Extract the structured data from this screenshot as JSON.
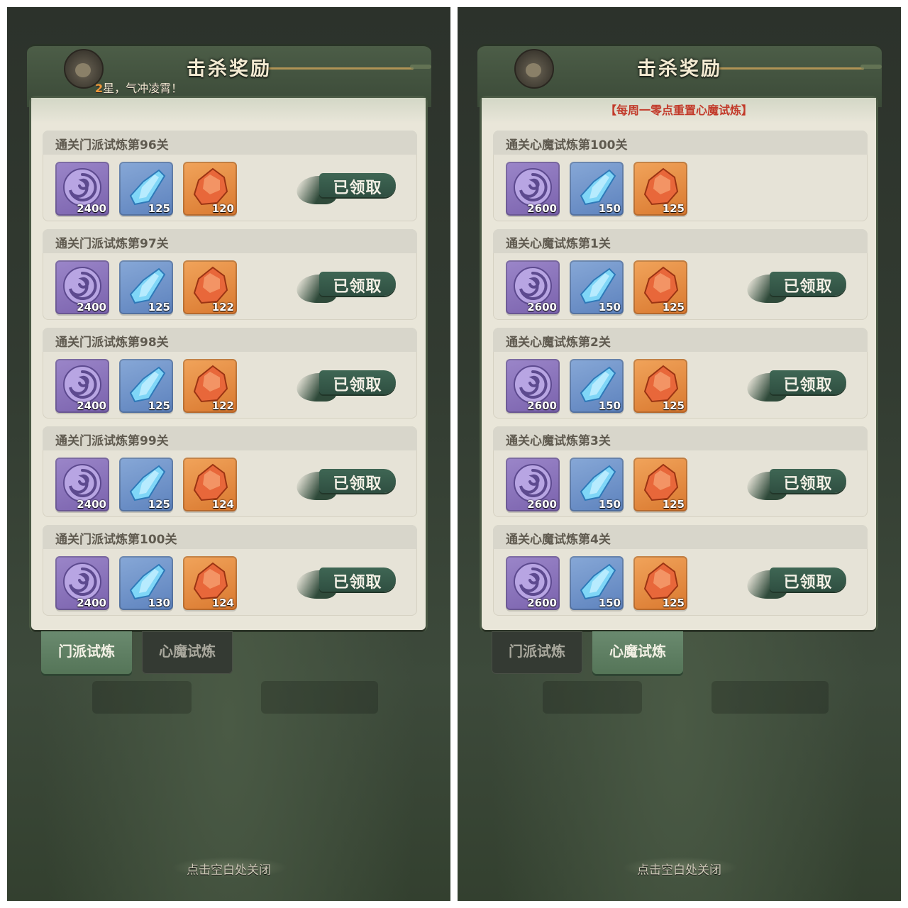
{
  "colors": {
    "panel_bg": "#e9e6d9",
    "notice_red": "#c23a2a",
    "tab_active": "#6a8a6f",
    "claimed_green": "#2f4f41",
    "item_purple": "#7a62ad",
    "item_blue": "#5d82bd",
    "item_orange": "#d9782f"
  },
  "screens": [
    {
      "title": "击杀奖励",
      "subtitle_num": "2",
      "subtitle_text": "星，气冲凌霄！",
      "notice": "",
      "tabs": [
        {
          "label": "门派试炼",
          "active": true,
          "icon": "tab"
        },
        {
          "label": "心魔试炼",
          "active": false,
          "icon": "tab"
        }
      ],
      "rows": [
        {
          "title": "通关门派试炼第96关",
          "items": [
            "2400",
            "125",
            "120"
          ],
          "status": "已领取"
        },
        {
          "title": "通关门派试炼第97关",
          "items": [
            "2400",
            "125",
            "122"
          ],
          "status": "已领取"
        },
        {
          "title": "通关门派试炼第98关",
          "items": [
            "2400",
            "125",
            "122"
          ],
          "status": "已领取"
        },
        {
          "title": "通关门派试炼第99关",
          "items": [
            "2400",
            "125",
            "124"
          ],
          "status": "已领取"
        },
        {
          "title": "通关门派试炼第100关",
          "items": [
            "2400",
            "130",
            "124"
          ],
          "status": "已领取"
        }
      ],
      "close_hint": "点击空白处关闭"
    },
    {
      "title": "击杀奖励",
      "subtitle_num": "",
      "subtitle_text": "",
      "notice": "【每周一零点重置心魔试炼】",
      "tabs": [
        {
          "label": "门派试炼",
          "active": false,
          "icon": "tab"
        },
        {
          "label": "心魔试炼",
          "active": true,
          "icon": "tab"
        }
      ],
      "rows": [
        {
          "title": "通关心魔试炼第100关",
          "items": [
            "2600",
            "150",
            "125"
          ],
          "status": ""
        },
        {
          "title": "通关心魔试炼第1关",
          "items": [
            "2600",
            "150",
            "125"
          ],
          "status": "已领取"
        },
        {
          "title": "通关心魔试炼第2关",
          "items": [
            "2600",
            "150",
            "125"
          ],
          "status": "已领取"
        },
        {
          "title": "通关心魔试炼第3关",
          "items": [
            "2600",
            "150",
            "125"
          ],
          "status": "已领取"
        },
        {
          "title": "通关心魔试炼第4关",
          "items": [
            "2600",
            "150",
            "125"
          ],
          "status": "已领取"
        }
      ],
      "close_hint": "点击空白处关闭"
    }
  ],
  "item_icons": [
    "purple-swirl-icon",
    "blue-crystal-icon",
    "orange-ore-icon"
  ]
}
